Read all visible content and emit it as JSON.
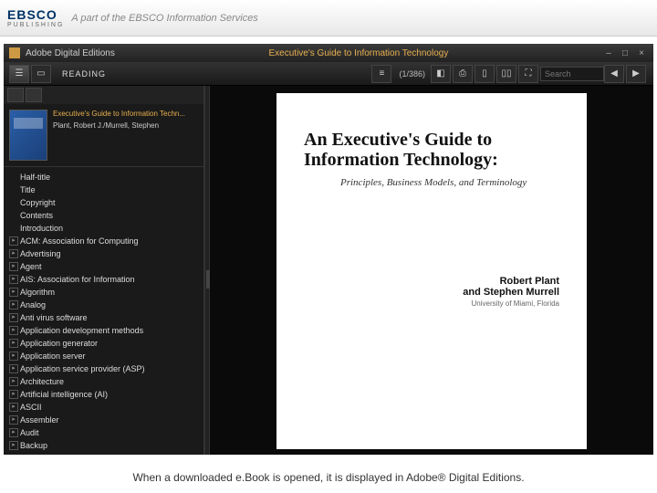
{
  "header": {
    "logo": "EBSCO",
    "logo_sub": "PUBLISHING",
    "tagline": "A part of the EBSCO Information Services"
  },
  "titlebar": {
    "app_name": "Adobe Digital Editions",
    "document_title": "Executive's Guide to Information Technology"
  },
  "toolbar": {
    "mode": "READING",
    "page_indicator": "(1/386)",
    "search_placeholder": "Search"
  },
  "sidebar": {
    "book_title": "Executive's Guide to Information Techn...",
    "book_authors": "Plant, Robert J./Murrell, Stephen",
    "toc": [
      {
        "label": "Half-title",
        "expandable": false
      },
      {
        "label": "Title",
        "expandable": false
      },
      {
        "label": "Copyright",
        "expandable": false
      },
      {
        "label": "Contents",
        "expandable": false
      },
      {
        "label": "Introduction",
        "expandable": false
      },
      {
        "label": "ACM: Association for Computing",
        "expandable": true
      },
      {
        "label": "Advertising",
        "expandable": true
      },
      {
        "label": "Agent",
        "expandable": true
      },
      {
        "label": "AIS: Association for Information",
        "expandable": true
      },
      {
        "label": "Algorithm",
        "expandable": true
      },
      {
        "label": "Analog",
        "expandable": true
      },
      {
        "label": "Anti virus software",
        "expandable": true
      },
      {
        "label": "Application development methods",
        "expandable": true
      },
      {
        "label": "Application generator",
        "expandable": true
      },
      {
        "label": "Application server",
        "expandable": true
      },
      {
        "label": "Application service provider (ASP)",
        "expandable": true
      },
      {
        "label": "Architecture",
        "expandable": true
      },
      {
        "label": "Artificial intelligence (AI)",
        "expandable": true
      },
      {
        "label": "ASCII",
        "expandable": true
      },
      {
        "label": "Assembler",
        "expandable": true
      },
      {
        "label": "Audit",
        "expandable": true
      },
      {
        "label": "Backup",
        "expandable": true
      }
    ]
  },
  "page": {
    "title": "An Executive's Guide to Information Technology:",
    "subtitle": "Principles, Business Models, and Terminology",
    "author1": "Robert Plant",
    "author_sep": "and ",
    "author2": "Stephen Murrell",
    "affiliation": "University of Miami, Florida"
  },
  "caption": "When a downloaded e.Book is opened, it is displayed in Adobe® Digital Editions."
}
